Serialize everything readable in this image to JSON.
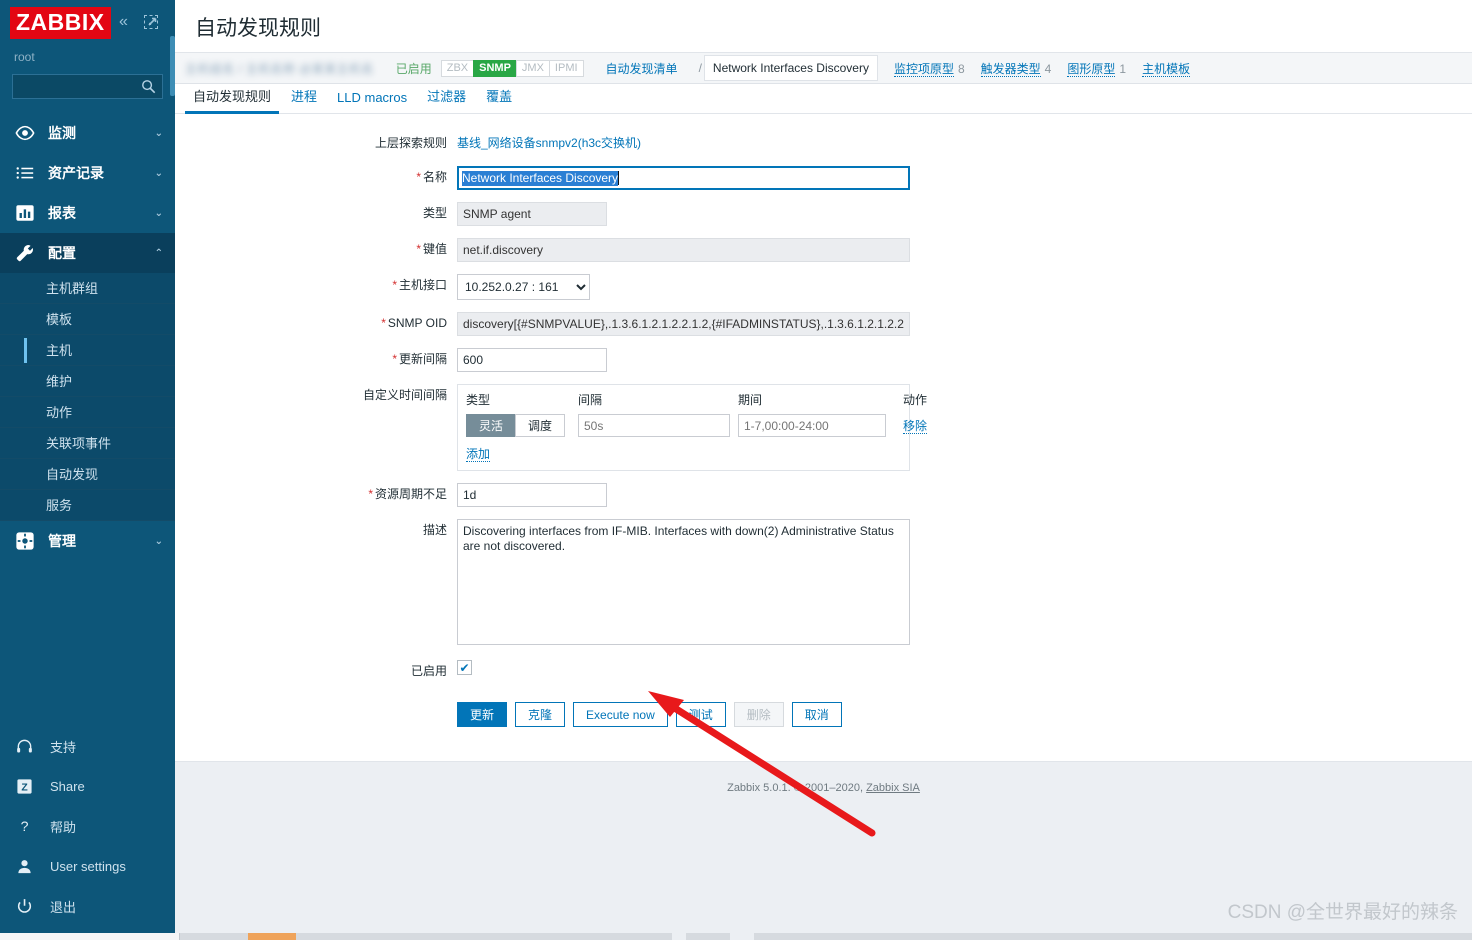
{
  "sidebar": {
    "logo": "ZABBIX",
    "collapse_icon": "chevron-double-left-icon",
    "expand_icon": "expand-icon",
    "user": "root",
    "search_placeholder": "",
    "search_value": "",
    "nav": [
      {
        "label": "监测",
        "icon": "eye-icon",
        "chevron": "⌄",
        "expanded": false
      },
      {
        "label": "资产记录",
        "icon": "list-icon",
        "chevron": "⌄",
        "expanded": false
      },
      {
        "label": "报表",
        "icon": "chart-bar-icon",
        "chevron": "⌄",
        "expanded": false
      },
      {
        "label": "配置",
        "icon": "wrench-icon",
        "chevron": "⌃",
        "expanded": true
      },
      {
        "label": "管理",
        "icon": "gear-icon",
        "chevron": "⌄",
        "expanded": false
      }
    ],
    "submenu": [
      {
        "label": "主机群组",
        "active": false
      },
      {
        "label": "模板",
        "active": false
      },
      {
        "label": "主机",
        "active": true
      },
      {
        "label": "维护",
        "active": false
      },
      {
        "label": "动作",
        "active": false
      },
      {
        "label": "关联项事件",
        "active": false
      },
      {
        "label": "自动发现",
        "active": false
      },
      {
        "label": "服务",
        "active": false
      }
    ],
    "bottom": [
      {
        "label": "支持",
        "icon": "headset-icon"
      },
      {
        "label": "Share",
        "icon": "zabbix-share-icon"
      },
      {
        "label": "帮助",
        "icon": "question-icon"
      },
      {
        "label": "User settings",
        "icon": "person-icon"
      },
      {
        "label": "退出",
        "icon": "power-icon"
      }
    ]
  },
  "header": {
    "title": "自动发现规则"
  },
  "breadcrumb": {
    "redacted_left": "主机组名 / 主机名称 @某某主机名",
    "status": "已启用",
    "protocols": [
      {
        "label": "ZBX",
        "active": false
      },
      {
        "label": "SNMP",
        "active": true
      },
      {
        "label": "JMX",
        "active": false
      },
      {
        "label": "IPMI",
        "active": false
      }
    ],
    "discovery_list": "自动发现清单",
    "separator": "/",
    "current": "Network Interfaces Discovery",
    "links": [
      {
        "label": "监控项原型",
        "count": "8"
      },
      {
        "label": "触发器类型",
        "count": "4"
      },
      {
        "label": "图形原型",
        "count": "1"
      },
      {
        "label": "主机模板",
        "count": ""
      }
    ]
  },
  "tabs": [
    {
      "label": "自动发现规则",
      "active": true
    },
    {
      "label": "进程",
      "active": false
    },
    {
      "label": "LLD macros",
      "active": false
    },
    {
      "label": "过滤器",
      "active": false
    },
    {
      "label": "覆盖",
      "active": false
    }
  ],
  "form": {
    "parent_rule_label": "上层探索规则",
    "parent_rule_value": "基线_网络设备snmpv2(h3c交换机)",
    "name_label": "名称",
    "name_value": "Network Interfaces Discovery",
    "type_label": "类型",
    "type_value": "SNMP agent",
    "key_label": "键值",
    "key_value": "net.if.discovery",
    "interface_label": "主机接口",
    "interface_value": "10.252.0.27 : 161",
    "snmp_oid_label": "SNMP OID",
    "snmp_oid_value": "discovery[{#SNMPVALUE},.1.3.6.1.2.1.2.2.1.2,{#IFADMINSTATUS},.1.3.6.1.2.1.2.2",
    "update_interval_label": "更新间隔",
    "update_interval_value": "600",
    "custom_intervals_label": "自定义时间间隔",
    "ci_headers": {
      "type": "类型",
      "interval": "间隔",
      "period": "期间",
      "action": "动作"
    },
    "ci_rows": [
      {
        "type_flexible": "灵活",
        "type_scheduling": "调度",
        "type_selected": "灵活",
        "interval_placeholder": "50s",
        "interval_value": "",
        "period_placeholder": "1-7,00:00-24:00",
        "period_value": "",
        "remove": "移除"
      }
    ],
    "ci_add": "添加",
    "lifetime_label": "资源周期不足",
    "lifetime_value": "1d",
    "description_label": "描述",
    "description_value": "Discovering interfaces from IF-MIB. Interfaces with down(2) Administrative Status are not discovered.",
    "enabled_label": "已启用",
    "enabled_checked": true,
    "check_glyph": "✔"
  },
  "buttons": [
    {
      "label": "更新",
      "style": "primary"
    },
    {
      "label": "克隆",
      "style": "default"
    },
    {
      "label": "Execute now",
      "style": "default"
    },
    {
      "label": "测试",
      "style": "default"
    },
    {
      "label": "删除",
      "style": "disabled"
    },
    {
      "label": "取消",
      "style": "default"
    }
  ],
  "footer": {
    "text": "Zabbix 5.0.1. © 2001–2020, ",
    "link": "Zabbix SIA"
  },
  "watermark": "CSDN @全世界最好的辣条",
  "colors": {
    "sidebar_bg": "#0d5679",
    "brand_red": "#e30613",
    "accent_blue": "#0275b8",
    "snmp_green": "#29a745",
    "annotation_red": "#e8191b",
    "selection_blue": "#2a7fd4"
  }
}
